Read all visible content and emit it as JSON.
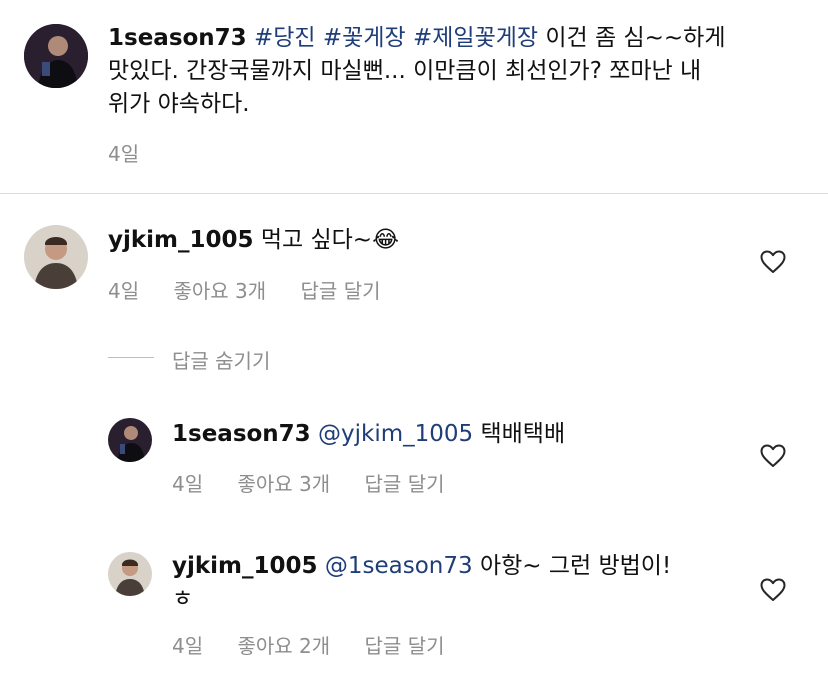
{
  "post": {
    "username": "1season73",
    "hashtags": [
      "#당진",
      "#꽃게장",
      "#제일꽃게장"
    ],
    "caption_line1": "이건 좀 심~~하게",
    "caption_line2": "맛있다. 간장국물까지 마실뻔... 이만큼이 최선인가? 쪼마난 내",
    "caption_line3": "위가 야속하다.",
    "time": "4일"
  },
  "comments": [
    {
      "username": "yjkim_1005",
      "text": "먹고 싶다~",
      "emoji": "😂",
      "time": "4일",
      "likes": "좋아요 3개",
      "reply": "답글 달기"
    }
  ],
  "hide_replies_label": "답글 숨기기",
  "replies": [
    {
      "username": "1season73",
      "mention": "@yjkim_1005",
      "text": "택배택배",
      "time": "4일",
      "likes": "좋아요 3개",
      "reply": "답글 달기"
    },
    {
      "username": "yjkim_1005",
      "mention": "@1season73",
      "text": "아항~ 그런 방법이!",
      "text_line2": "ㅎ",
      "time": "4일",
      "likes": "좋아요 2개",
      "reply": "답글 달기"
    }
  ],
  "colors": {
    "link": "#1f3d78",
    "meta": "#8e8e8e",
    "divider": "#dbdbdb"
  },
  "icons": {
    "like": "heart-outline-icon"
  }
}
